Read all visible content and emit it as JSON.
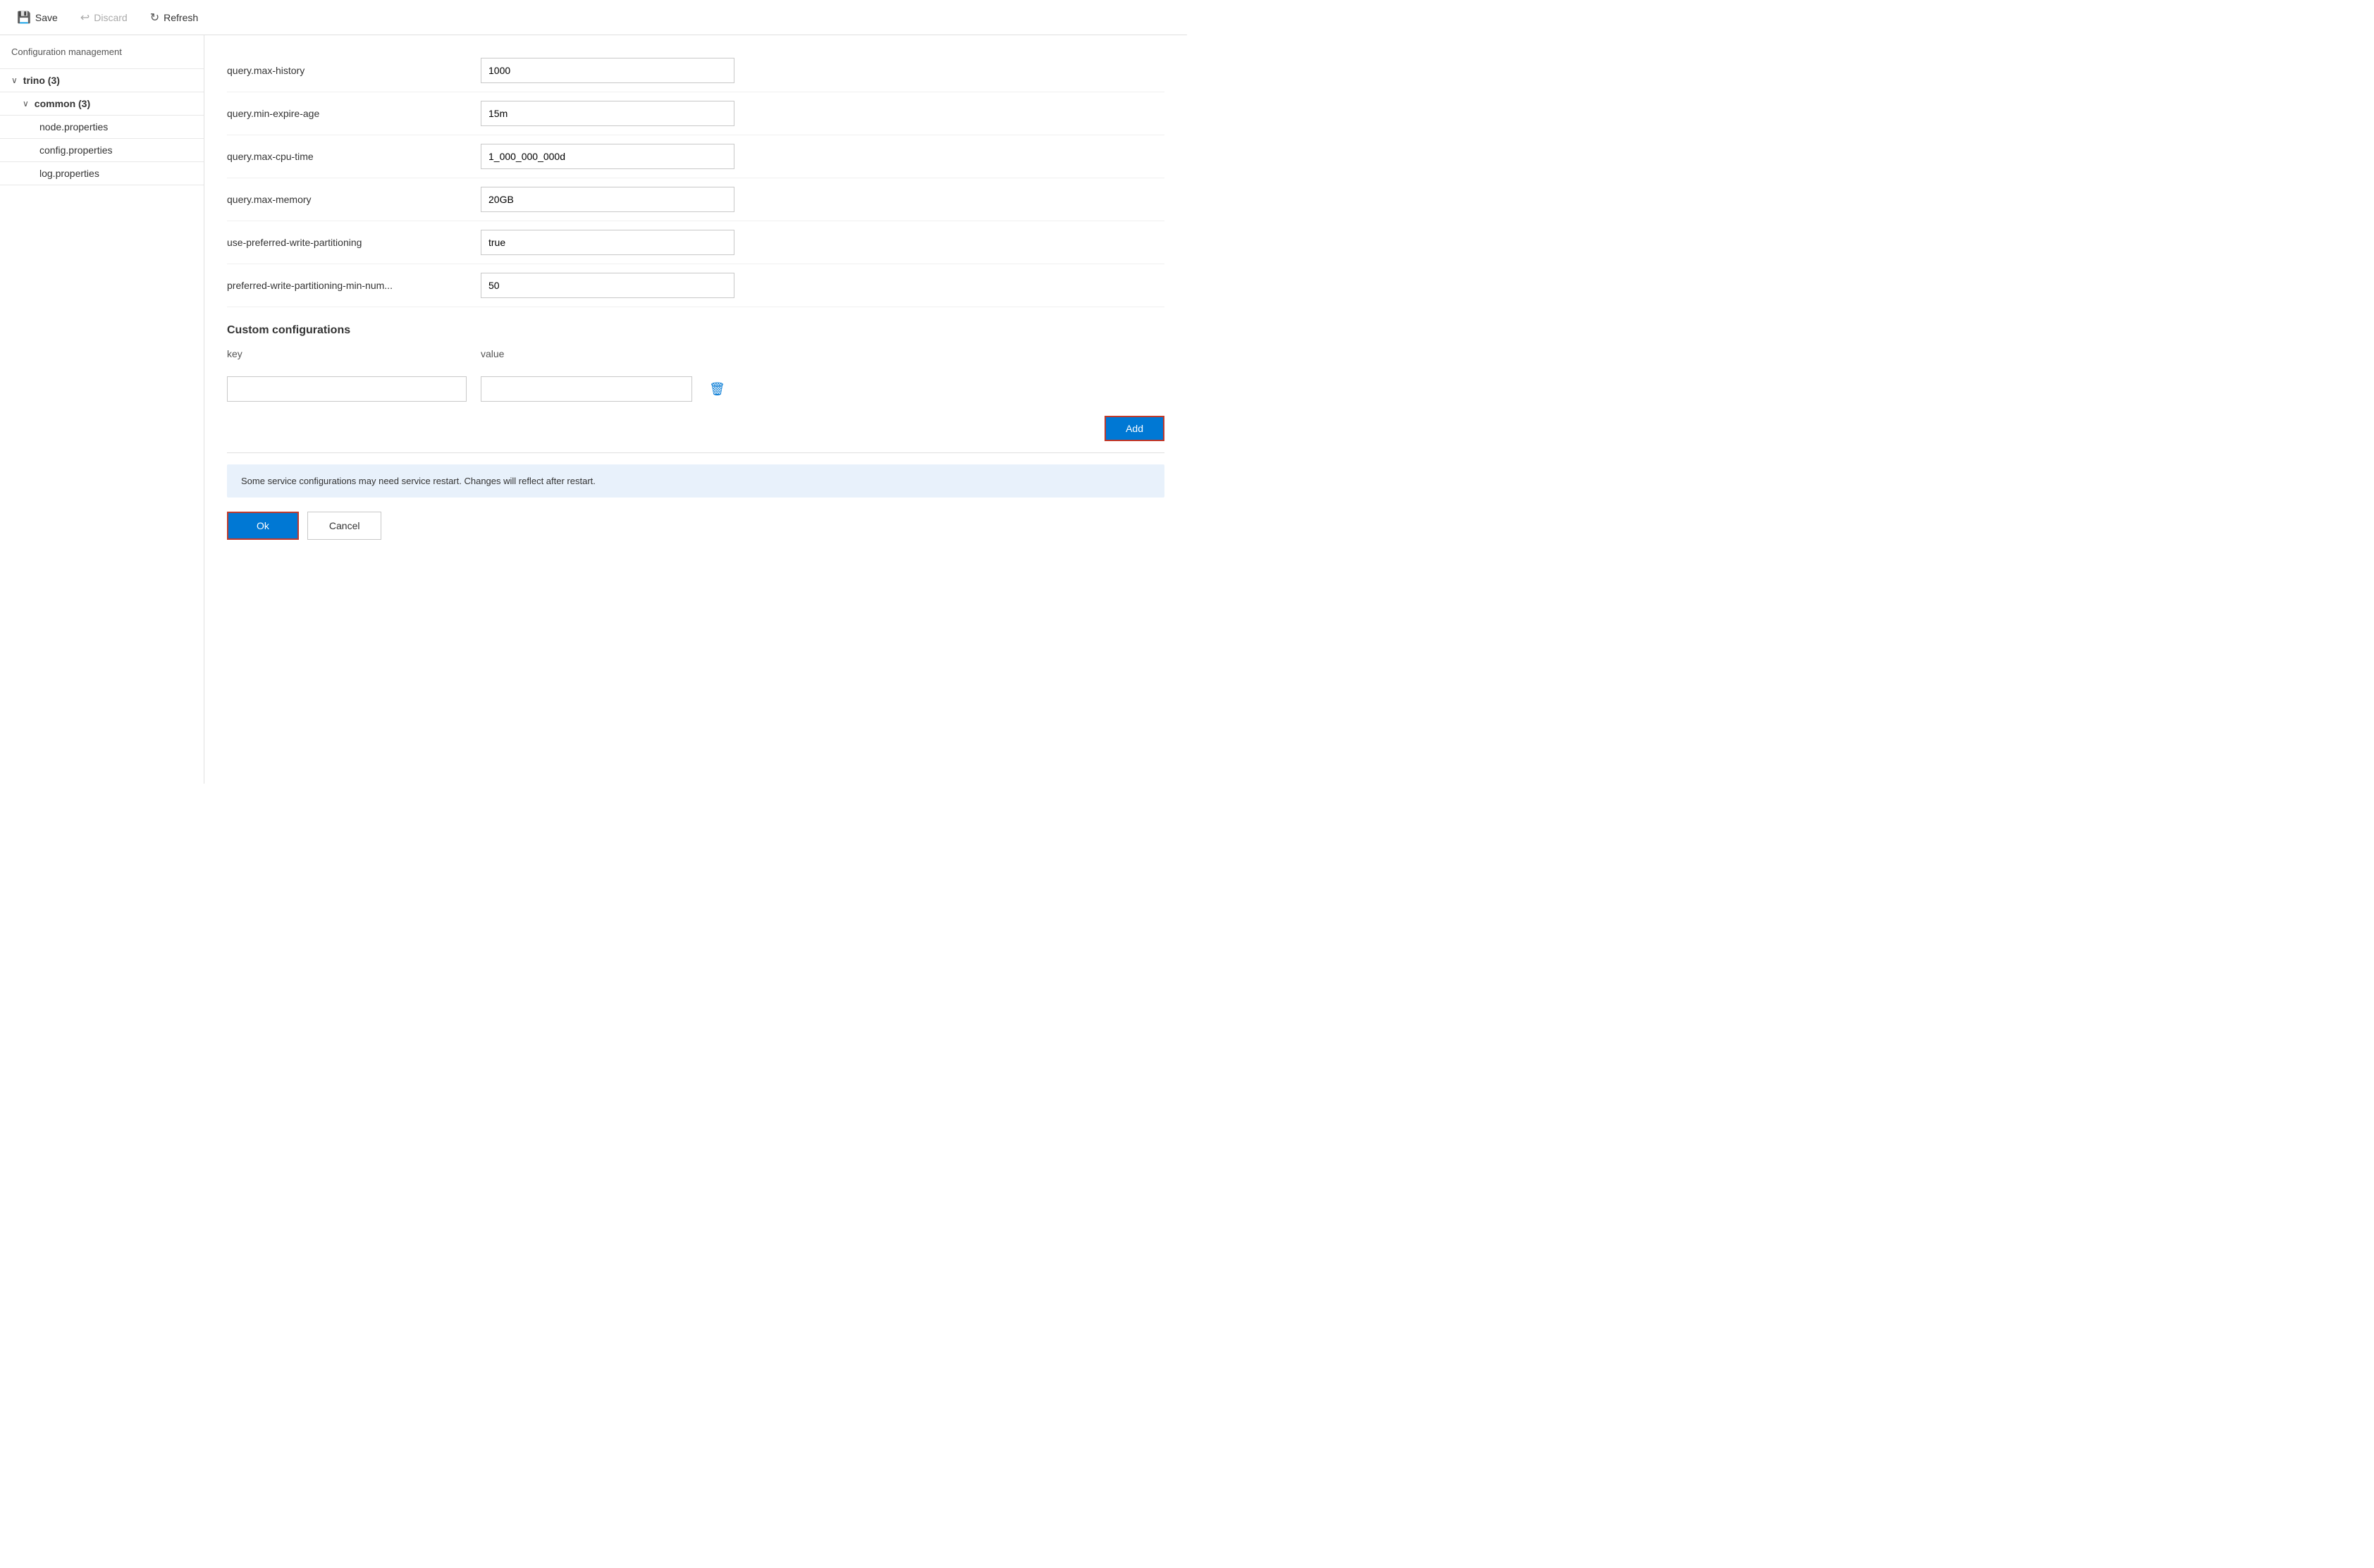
{
  "toolbar": {
    "save_label": "Save",
    "discard_label": "Discard",
    "refresh_label": "Refresh"
  },
  "sidebar": {
    "title": "Configuration management",
    "tree": {
      "trino_label": "trino (3)",
      "common_label": "common (3)",
      "files": [
        "node.properties",
        "config.properties",
        "log.properties"
      ]
    }
  },
  "config_rows": [
    {
      "key": "query.max-history",
      "value": "1000"
    },
    {
      "key": "query.min-expire-age",
      "value": "15m"
    },
    {
      "key": "query.max-cpu-time",
      "value": "1_000_000_000d"
    },
    {
      "key": "query.max-memory",
      "value": "20GB"
    },
    {
      "key": "use-preferred-write-partitioning",
      "value": "true"
    },
    {
      "key": "preferred-write-partitioning-min-num...",
      "value": "50"
    }
  ],
  "custom_configurations": {
    "section_title": "Custom configurations",
    "col_key": "key",
    "col_value": "value",
    "key_placeholder": "",
    "value_placeholder": "",
    "add_label": "Add"
  },
  "info_banner": {
    "message": "Some service configurations may need service restart. Changes will reflect after restart."
  },
  "actions": {
    "ok_label": "Ok",
    "cancel_label": "Cancel"
  }
}
